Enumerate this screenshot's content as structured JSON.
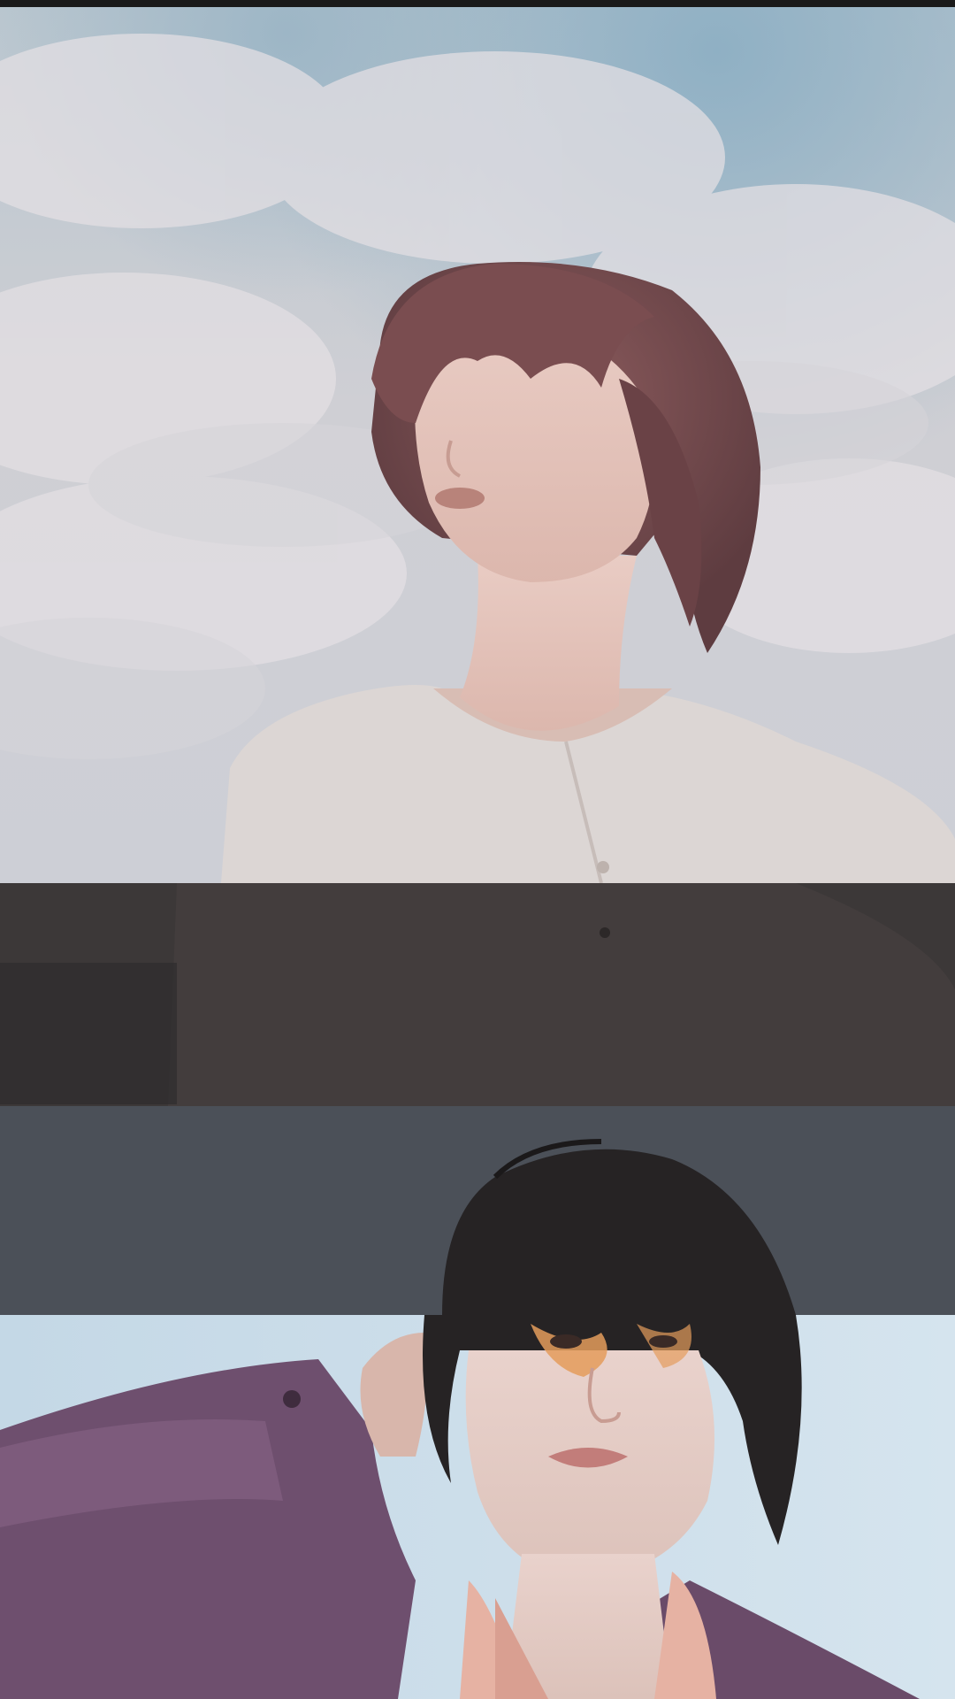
{
  "images": {
    "top": {
      "description_icon": "photo-sky-portrait"
    },
    "bottom": {
      "description_icon": "photo-studio-portrait"
    }
  },
  "colors": {
    "sky": "#c9cfd6",
    "sky_blue": "#8fb0c4",
    "band_dark": "#3c3838",
    "band_slate": "#4b5058",
    "wall": "#c9dce9",
    "jacket": "#6e4f6e",
    "shirt": "#e6b2a3"
  }
}
